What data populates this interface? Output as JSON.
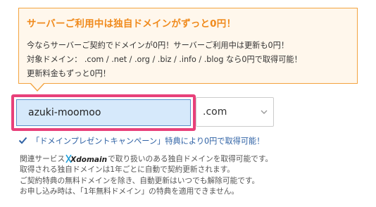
{
  "promo": {
    "title": "サーバーご利用中は独自ドメインがずっと0円！",
    "line1": "今ならサーバーご契約でドメインが0円！サーバーご利用中は更新も0円！",
    "line2": "対象ドメイン： .com / .net / .org / .biz / .info / .blog なら0円で取得可能！",
    "line3": "更新料金もずっと0円！",
    "accent_color": "#f08a1c",
    "background_color": "#fff7ec"
  },
  "domain_form": {
    "domain_value": "azuki-moomoo",
    "tld_selected": ".com",
    "highlight_color": "#e8407a",
    "input_background": "#d6e9fb"
  },
  "campaign": {
    "text": "「ドメインプレゼントキャンペーン」特典により0円で取得可能！",
    "icon": "check-icon",
    "color": "#2f62a5"
  },
  "notes": {
    "line1_prefix": "関連サービス",
    "xdomain_logo": "Xdomain",
    "line1_suffix": "で取り扱いのある独自ドメインを取得可能です。",
    "line2": "取得される独自ドメインは1年ごとに自動で契約更新されます。",
    "line3": "ご契約特典の無料ドメインを除き、自動更新はいつでも解除可能です。",
    "line4": "お申し込み時は、「1年無料ドメイン」の特典を適用できません。"
  }
}
